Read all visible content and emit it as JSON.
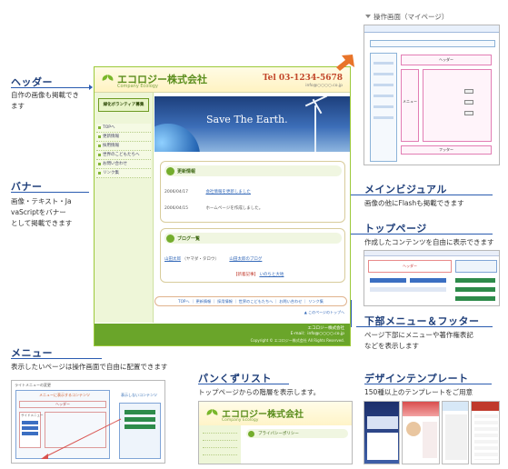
{
  "annotations": {
    "header": {
      "title": "ヘッダー",
      "desc": [
        "自作の画像も掲載でき",
        "ます"
      ]
    },
    "banner": {
      "title": "バナー",
      "desc": [
        "画像・テキスト・Ja",
        "vaScriptをバナー",
        "として掲載できます"
      ]
    },
    "menu": {
      "title": "メニュー",
      "desc": [
        "表示したいページは操作画面で自由に配置できます"
      ]
    },
    "main_visual": {
      "title": "メインビジュアル",
      "desc": [
        "画像の他にFlashも掲載できます"
      ]
    },
    "top_page": {
      "title": "トップページ",
      "desc": [
        "作成したコンテンツを自由に表示できます"
      ]
    },
    "sub_menu_footer": {
      "title": "下部メニュー＆フッター",
      "desc": [
        "ページ下部にメニューや著作権表記",
        "などを表示します"
      ]
    },
    "breadcrumb": {
      "title": "パンくずリスト",
      "desc": [
        "トップページからの階層を表示します。"
      ]
    },
    "design_template": {
      "title": "デザインテンプレート",
      "desc": [
        "150種以上のテンプレートをご用意"
      ]
    },
    "admin_screen": {
      "label": "操作画面（マイページ）"
    }
  },
  "mock": {
    "company": "エコロジー株式会社",
    "company_en": "Company Ecology",
    "tel": "Tel 03-1234-5678",
    "email": "info@○○○○.co.jp",
    "banner": "緑化ボランティア募集",
    "menu": [
      "TOPへ",
      "更新情報",
      "採用情報",
      "世界のこどもたちへ",
      "お問い合わせ",
      "リンク集"
    ],
    "visual_text": "Save The Earth.",
    "news_title": "更新情報",
    "news": [
      {
        "date": "2006/04/17",
        "text": "会社情報を更新しました"
      },
      {
        "date": "2006/04/15",
        "text": "ホームページを作成しました。"
      }
    ],
    "blog_title": "ブログ一覧",
    "blog_name": "山田太郎",
    "blog_author": "（ヤマダ・タロウ）",
    "blog_entry": "山田太郎のブログ",
    "blog_more_red": "【新着記事】",
    "blog_more_link": "いのちと大地",
    "submenu": "TOPへ ｜ 更新情報 ｜ 採用情報 ｜ 世界のこどもたちへ ｜ お問い合わせ ｜ リンク集",
    "pagetop": "▲ このページのトップへ",
    "footer_name": "エコロジー株式会社",
    "footer_mail": "E-mail：info@○○○○.co.jp",
    "copyright": "Copyright © エコロジー株式会社 All Rights Reserved."
  },
  "thumbs": {
    "menu_header": "ヘッダー",
    "menu_red": "メニューに表示するコンテンツ",
    "menu_side": "表示しないコンテンツ",
    "menu_caption": "ライトメニューの変更",
    "menu_item": "サイドメニュー",
    "bc_company": "エコロジー株式会社",
    "bc_company_en": "Company Ecology",
    "bc_crumb": "ブライバシーポリシー",
    "top_header": "ヘッダー",
    "admin_header": "ヘッダー",
    "admin_menu": "メニュー",
    "admin_footer": "フッター"
  },
  "colors": {
    "accent": "#2a5bb0",
    "brand_green": "#6aa52a",
    "annotation_title": "#1f3f7a"
  }
}
